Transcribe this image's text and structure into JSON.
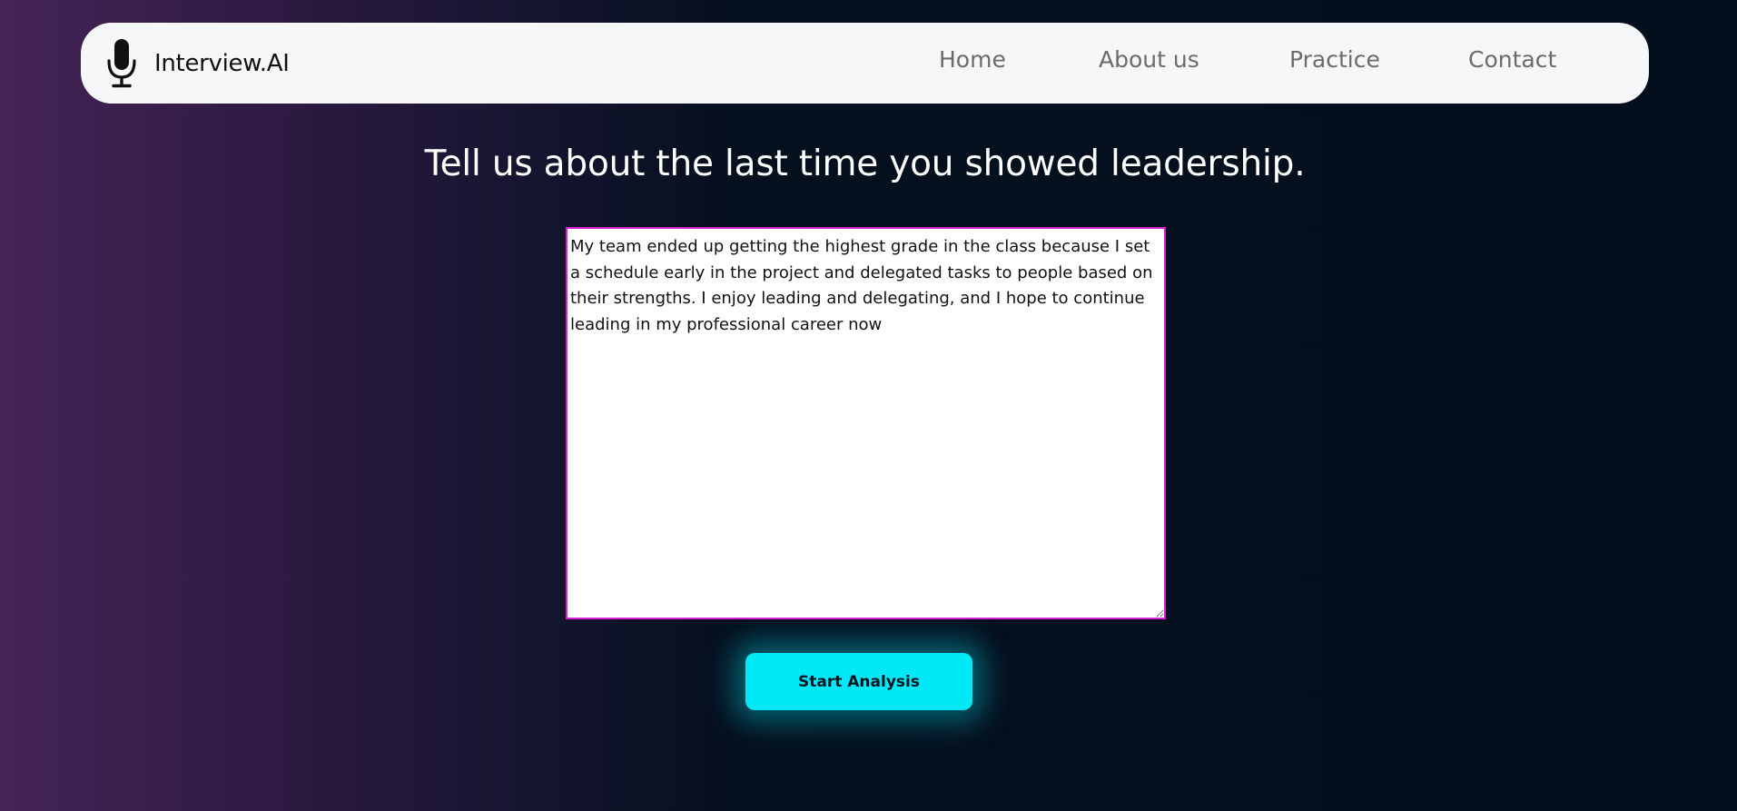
{
  "nav": {
    "brand": "Interview.AI",
    "brand_icon": "microphone-icon",
    "links": [
      "Home",
      "About us",
      "Practice",
      "Contact"
    ]
  },
  "main": {
    "question": "Tell us about the last time you showed leadership.",
    "answer_value": "My team ended up getting the highest grade in the class because I set a schedule early in the project and delegated tasks to people based on their strengths. I enjoy leading and delegating, and I hope to continue leading in my professional career now",
    "start_button_label": "Start Analysis"
  },
  "colors": {
    "textarea_border": "#d91fd3",
    "button_bg": "#00e8f5",
    "nav_bg": "#f6f7f9"
  }
}
